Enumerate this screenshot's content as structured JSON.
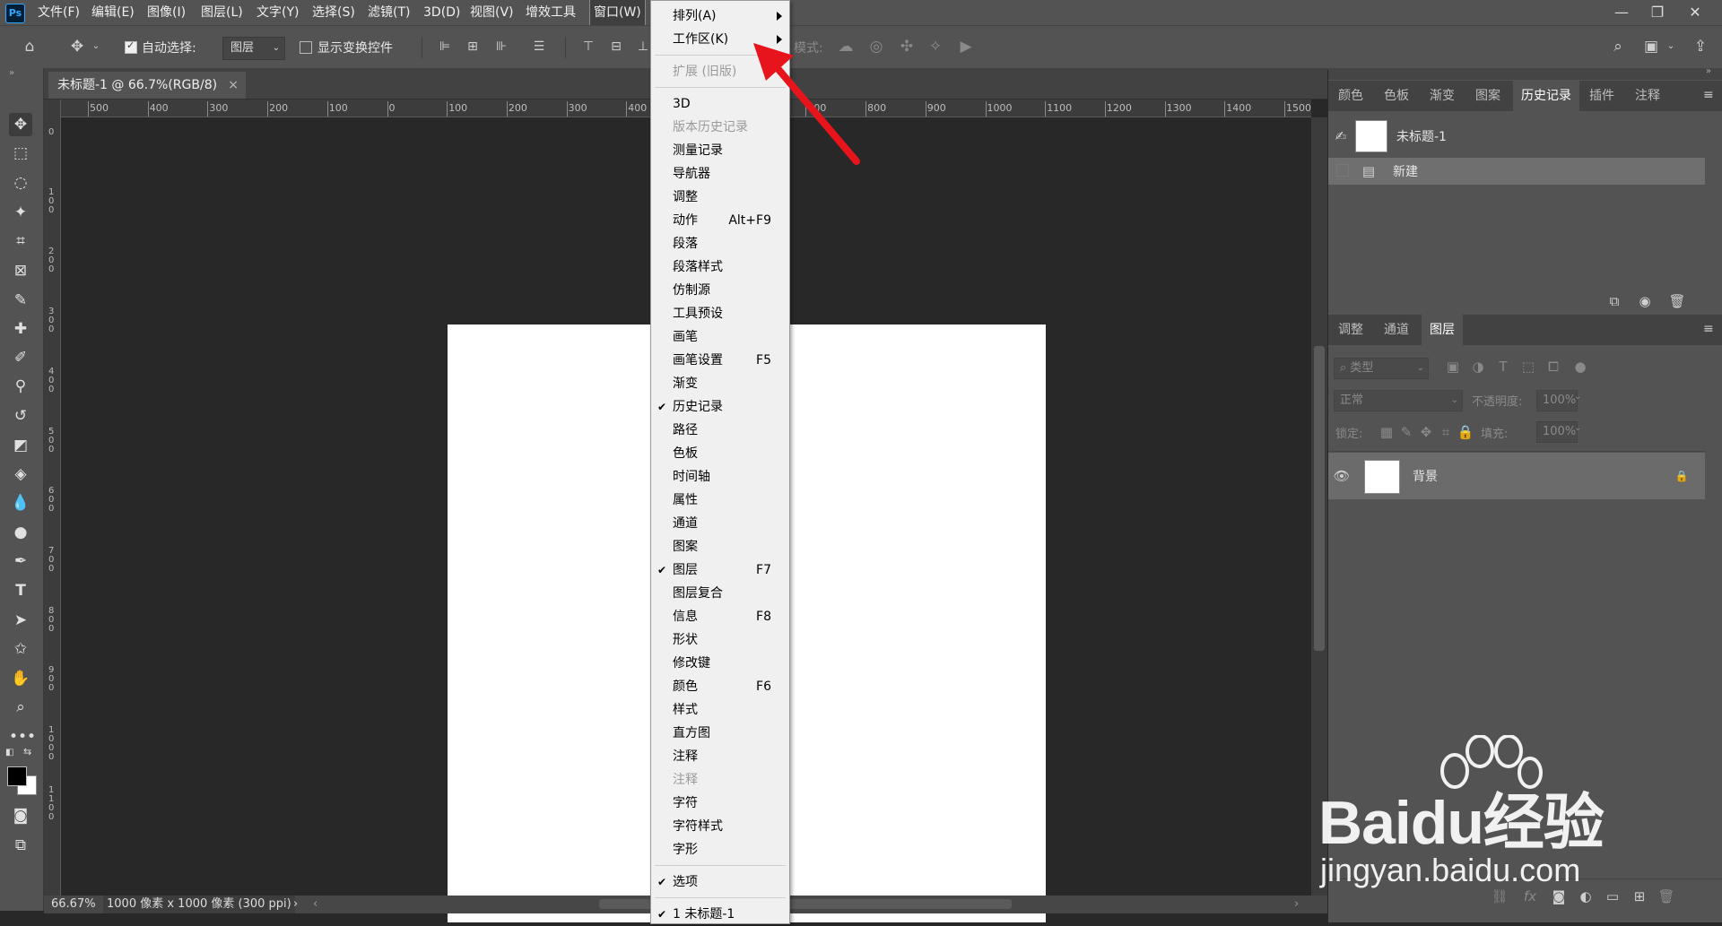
{
  "app": {
    "logo": "Ps"
  },
  "menubar": {
    "items": [
      "文件(F)",
      "编辑(E)",
      "图像(I)",
      "图层(L)",
      "文字(Y)",
      "选择(S)",
      "滤镜(T)",
      "3D(D)",
      "视图(V)",
      "增效工具",
      "窗口(W)"
    ],
    "active_item": "窗口(W)"
  },
  "window_controls": {
    "minimize": "—",
    "restore": "❐",
    "close": "✕"
  },
  "options_bar": {
    "auto_select_label": "自动选择:",
    "auto_select_checked": true,
    "auto_select_target": "图层",
    "show_transform_label": "显示变换控件",
    "show_transform_checked": false,
    "mode_label": "模式:"
  },
  "document_tab": {
    "title": "未标题-1 @ 66.7%(RGB/8)",
    "close": "×"
  },
  "ruler": {
    "h_ticks": [
      "500",
      "400",
      "300",
      "200",
      "100",
      "0",
      "100",
      "200",
      "300",
      "400",
      "500",
      "600",
      "700",
      "800",
      "900",
      "1000",
      "1100",
      "1200",
      "1300",
      "1400",
      "1500"
    ],
    "v_ticks": [
      "0",
      "1\n0\n0",
      "2\n0\n0",
      "3\n0\n0",
      "4\n0\n0",
      "5\n0\n0",
      "6\n0\n0",
      "7\n0\n0",
      "8\n0\n0",
      "9\n0\n0",
      "1\n0\n0\n0",
      "1\n1\n0\n0"
    ]
  },
  "status_bar": {
    "zoom": "66.67%",
    "doc_info": "1000 像素 x 1000 像素 (300 ppi)",
    "more": "›"
  },
  "history_panel": {
    "tabs": [
      "颜色",
      "色板",
      "渐变",
      "图案",
      "历史记录",
      "插件",
      "注释"
    ],
    "active_tab": "历史记录",
    "snapshot_name": "未标题-1",
    "steps": [
      "新建"
    ]
  },
  "layers_panel": {
    "tabs": [
      "调整",
      "通道",
      "图层"
    ],
    "active_tab": "图层",
    "filter_kind": "类型",
    "blend_mode": "正常",
    "opacity_label": "不透明度:",
    "opacity_value": "100%",
    "lock_label": "锁定:",
    "fill_label": "填充:",
    "fill_value": "100%",
    "layers": [
      {
        "name": "背景",
        "visible": true,
        "locked": true
      }
    ]
  },
  "window_menu": {
    "items": [
      {
        "label": "排列(A)",
        "submenu": true
      },
      {
        "label": "工作区(K)",
        "submenu": true
      },
      {
        "sep": true
      },
      {
        "label": "扩展 (旧版)",
        "disabled": true
      },
      {
        "sep": true
      },
      {
        "label": "3D"
      },
      {
        "label": "版本历史记录",
        "disabled": true
      },
      {
        "label": "测量记录"
      },
      {
        "label": "导航器"
      },
      {
        "label": "调整"
      },
      {
        "label": "动作",
        "shortcut": "Alt+F9"
      },
      {
        "label": "段落"
      },
      {
        "label": "段落样式"
      },
      {
        "label": "仿制源"
      },
      {
        "label": "工具预设"
      },
      {
        "label": "画笔"
      },
      {
        "label": "画笔设置",
        "shortcut": "F5"
      },
      {
        "label": "渐变"
      },
      {
        "label": "历史记录",
        "checked": true
      },
      {
        "label": "路径"
      },
      {
        "label": "色板"
      },
      {
        "label": "时间轴"
      },
      {
        "label": "属性"
      },
      {
        "label": "通道"
      },
      {
        "label": "图案"
      },
      {
        "label": "图层",
        "checked": true,
        "shortcut": "F7"
      },
      {
        "label": "图层复合"
      },
      {
        "label": "信息",
        "shortcut": "F8"
      },
      {
        "label": "形状"
      },
      {
        "label": "修改键"
      },
      {
        "label": "颜色",
        "shortcut": "F6"
      },
      {
        "label": "样式"
      },
      {
        "label": "直方图"
      },
      {
        "label": "注释"
      },
      {
        "label": "注释",
        "disabled": true
      },
      {
        "label": "字符"
      },
      {
        "label": "字符样式"
      },
      {
        "label": "字形"
      },
      {
        "sep": true
      },
      {
        "label": "选项",
        "checked": true
      },
      {
        "sep": true
      },
      {
        "label": "1 未标题-1",
        "checked": true
      }
    ]
  },
  "watermark": {
    "brand": "Baidu经验",
    "url": "jingyan.baidu.com"
  },
  "colors": {
    "ui_bg": "#535353",
    "canvas_bg": "#282828",
    "menu_bg": "#f0f0f0",
    "arrow": "#e8141b"
  }
}
